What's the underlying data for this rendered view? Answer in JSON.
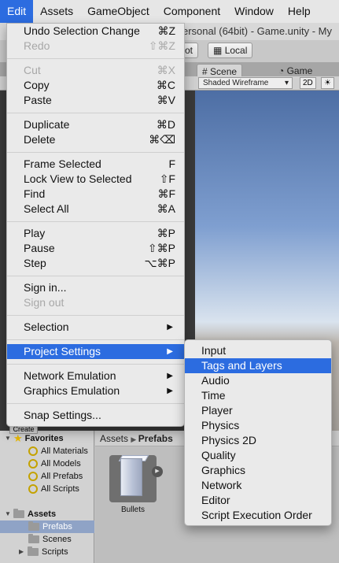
{
  "menubar": {
    "items": [
      "Edit",
      "Assets",
      "GameObject",
      "Component",
      "Window",
      "Help"
    ]
  },
  "window": {
    "title": "ersonal (64bit) - Game.unity - My"
  },
  "toolbar": {
    "pivot_label": "vot",
    "local_label": "Local"
  },
  "scene_tabs": {
    "scene": "Scene",
    "game": "Game"
  },
  "scene_controls": {
    "shading_mode": "Shaded Wireframe",
    "mode_2d": "2D"
  },
  "edit_menu": {
    "undo": {
      "label": "Undo Selection Change",
      "shortcut": "⌘Z"
    },
    "redo": {
      "label": "Redo",
      "shortcut": "⇧⌘Z"
    },
    "cut": {
      "label": "Cut",
      "shortcut": "⌘X"
    },
    "copy": {
      "label": "Copy",
      "shortcut": "⌘C"
    },
    "paste": {
      "label": "Paste",
      "shortcut": "⌘V"
    },
    "duplicate": {
      "label": "Duplicate",
      "shortcut": "⌘D"
    },
    "delete": {
      "label": "Delete",
      "shortcut": "⌘⌫"
    },
    "frame_selected": {
      "label": "Frame Selected",
      "shortcut": "F"
    },
    "lock_view": {
      "label": "Lock View to Selected",
      "shortcut": "⇧F"
    },
    "find": {
      "label": "Find",
      "shortcut": "⌘F"
    },
    "select_all": {
      "label": "Select All",
      "shortcut": "⌘A"
    },
    "play": {
      "label": "Play",
      "shortcut": "⌘P"
    },
    "pause": {
      "label": "Pause",
      "shortcut": "⇧⌘P"
    },
    "step": {
      "label": "Step",
      "shortcut": "⌥⌘P"
    },
    "sign_in": {
      "label": "Sign in..."
    },
    "sign_out": {
      "label": "Sign out"
    },
    "selection": {
      "label": "Selection"
    },
    "project_settings": {
      "label": "Project Settings"
    },
    "network_emulation": {
      "label": "Network Emulation"
    },
    "graphics_emulation": {
      "label": "Graphics Emulation"
    },
    "snap_settings": {
      "label": "Snap Settings..."
    }
  },
  "project_settings_menu": {
    "items": [
      "Input",
      "Tags and Layers",
      "Audio",
      "Time",
      "Player",
      "Physics",
      "Physics 2D",
      "Quality",
      "Graphics",
      "Network",
      "Editor",
      "Script Execution Order"
    ]
  },
  "project_panel": {
    "create_label": "Create",
    "favorites": {
      "title": "Favorites",
      "items": [
        "All Materials",
        "All Models",
        "All Prefabs",
        "All Scripts"
      ]
    },
    "assets": {
      "title": "Assets",
      "children": [
        "Prefabs",
        "Scenes",
        "Scripts"
      ]
    },
    "breadcrumb": {
      "root": "Assets",
      "current": "Prefabs"
    },
    "asset_items": [
      {
        "name": "Bullets"
      }
    ]
  }
}
